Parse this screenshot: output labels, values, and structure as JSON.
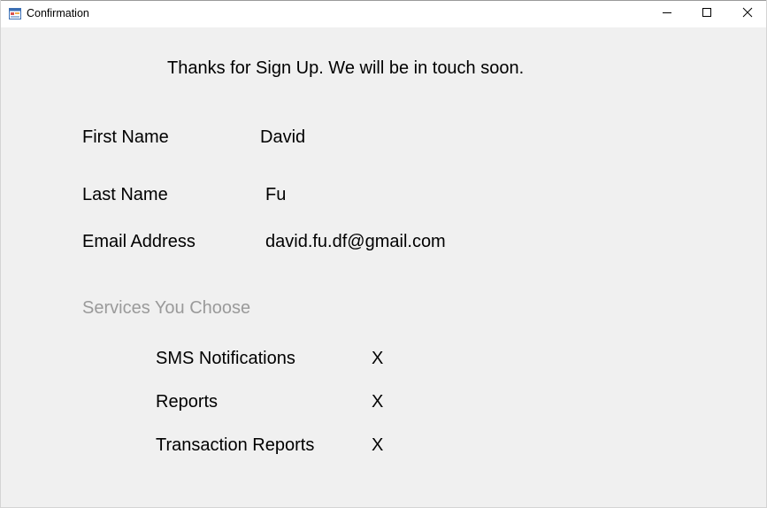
{
  "window": {
    "title": "Confirmation",
    "app_icon": "winforms-app-icon",
    "controls": {
      "minimize_icon": "minimize-icon",
      "maximize_icon": "maximize-icon",
      "close_icon": "close-icon"
    }
  },
  "content": {
    "heading": "Thanks for Sign Up. We will be in touch soon.",
    "fields": {
      "first_name": {
        "label": "First Name",
        "value": "David"
      },
      "last_name": {
        "label": "Last Name",
        "value": "Fu"
      },
      "email": {
        "label": "Email Address",
        "value": "david.fu.df@gmail.com"
      }
    },
    "services": {
      "title": "Services You Choose",
      "title_color": "#9a9a9a",
      "items": [
        {
          "label": "SMS Notifications",
          "mark": "X"
        },
        {
          "label": "Reports",
          "mark": "X"
        },
        {
          "label": "Transaction Reports",
          "mark": "X"
        }
      ]
    }
  }
}
